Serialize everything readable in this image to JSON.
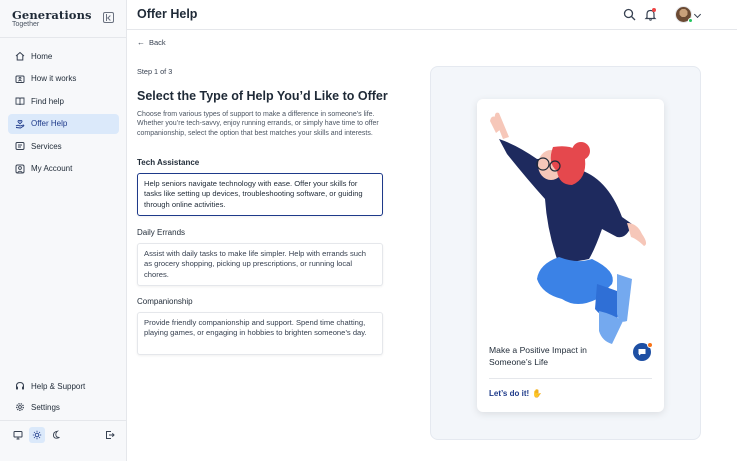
{
  "app": {
    "brand_title": "Generations",
    "brand_subtitle": "Together"
  },
  "sidebar": {
    "items": [
      {
        "label": "Home",
        "icon": "home-icon"
      },
      {
        "label": "How it works",
        "icon": "info-icon"
      },
      {
        "label": "Find help",
        "icon": "book-icon"
      },
      {
        "label": "Offer Help",
        "icon": "hand-heart-icon",
        "active": true
      },
      {
        "label": "Services",
        "icon": "services-icon"
      },
      {
        "label": "My Account",
        "icon": "account-icon"
      }
    ],
    "bottom_items": [
      {
        "label": "Help & Support",
        "icon": "headset-icon"
      },
      {
        "label": "Settings",
        "icon": "gear-icon"
      }
    ],
    "theme_options": [
      "monitor-icon",
      "sun-icon",
      "moon-icon"
    ],
    "active_theme": "sun-icon"
  },
  "header": {
    "title": "Offer Help"
  },
  "main": {
    "back_label": "Back",
    "step_label": "Step 1 of 3",
    "heading": "Select the Type of Help You’d Like to Offer",
    "intro": "Choose from various types of support to make a difference in someone’s life. Whether you’re tech-savvy, enjoy running errands, or simply have time to offer companionship, select the option that best matches your skills and interests.",
    "options": [
      {
        "title": "Tech Assistance",
        "description": "Help seniors navigate technology with ease. Offer your skills for tasks like setting up devices, troubleshooting software, or guiding through online activities.",
        "selected": true
      },
      {
        "title": "Daily Errands",
        "description": "Assist with daily tasks to make life simpler. Help with errands such as grocery shopping, picking up prescriptions, or running local chores.",
        "selected": false
      },
      {
        "title": "Companionship",
        "description": "Provide friendly companionship and support. Spend time chatting, playing games, or engaging in hobbies to brighten someone’s day.",
        "selected": false
      }
    ]
  },
  "promo": {
    "title": "Make a Positive Impact in Someone’s Life",
    "cta_label": "Let’s do it!"
  },
  "colors": {
    "accent": "#1e3a8a",
    "active_nav_bg": "#dbe9fa",
    "illustration_sweater": "#1e2a5e",
    "illustration_pants": "#3b82e6",
    "illustration_hair": "#e5484d",
    "notification": "#ef4444"
  }
}
